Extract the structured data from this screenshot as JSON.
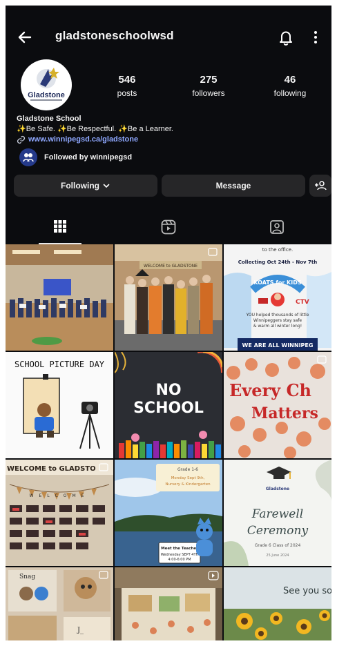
{
  "header": {
    "username": "gladstoneschoolwsd",
    "icons": [
      "back-arrow-icon",
      "bell-icon",
      "more-icon"
    ]
  },
  "profile": {
    "avatar_text": "Gladstone",
    "stats": [
      {
        "value": "546",
        "label": "posts"
      },
      {
        "value": "275",
        "label": "followers"
      },
      {
        "value": "46",
        "label": "following"
      }
    ],
    "name": "Gladstone School",
    "bio": "✨Be Safe. ✨Be Respectful. ✨Be a Learner.",
    "link": "www.winnipegsd.ca/gladstone",
    "followed_by": "Followed by winnipegsd"
  },
  "actions": {
    "following_label": "Following",
    "message_label": "Message"
  },
  "tabs": [
    "grid-icon",
    "reels-icon",
    "tagged-icon"
  ],
  "posts": [
    {
      "id": "p1"
    },
    {
      "id": "p2",
      "text": "WELCOME to GLADSTONE"
    },
    {
      "id": "p3",
      "lines": [
        "to the office.",
        "Collecting Oct 24th - Nov 7th",
        "KOATS for KIDS",
        "YOU helped thousands of little",
        "Winnipeggers stay safe",
        "& warm all winter long!",
        "WE ARE ALL WINNIPEG"
      ]
    },
    {
      "id": "p4",
      "text": "SCHOOL PICTURE DAY"
    },
    {
      "id": "p5",
      "lines": [
        "NO",
        "SCHOOL"
      ]
    },
    {
      "id": "p6",
      "lines": [
        "Every Ch",
        "Matters"
      ]
    },
    {
      "id": "p7",
      "lines": [
        "WELCOME to GLADSTO",
        "WELCOME"
      ]
    },
    {
      "id": "p8",
      "lines": [
        "Grade 1-6",
        "Monday Sept 9th,",
        "Nursery & Kindergarten",
        "Meet the Teacher",
        "Wednesday SEPT 4TH",
        "4:00-6:00 PM"
      ]
    },
    {
      "id": "p9",
      "lines": [
        "Gladstone",
        "Farewell",
        "Ceremony",
        "Grade 6 Class of 2024",
        "25 June 2024"
      ]
    },
    {
      "id": "p10",
      "lines": [
        "Snag",
        "J_"
      ]
    },
    {
      "id": "p11"
    },
    {
      "id": "p12",
      "text": "See you soon!"
    }
  ]
}
